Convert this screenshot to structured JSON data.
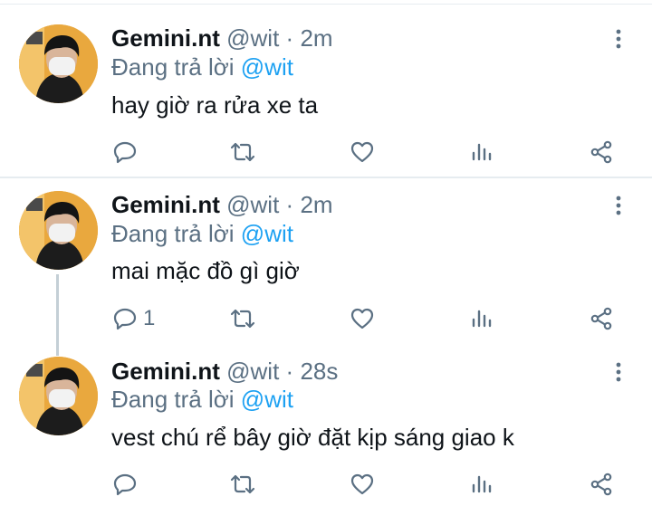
{
  "tweets": [
    {
      "name": "Gemini.nt",
      "handle": "@wit",
      "sep": "·",
      "time": "2m",
      "reply_prefix": "Đang trả lời",
      "reply_to": "@wit",
      "text": "hay giờ ra rửa xe ta",
      "reply_count": "",
      "icons": {
        "reply": "reply-icon",
        "retweet": "retweet-icon",
        "like": "heart-icon",
        "analytics": "analytics-icon",
        "share": "share-icon",
        "more": "more-vertical-icon"
      }
    },
    {
      "name": "Gemini.nt",
      "handle": "@wit",
      "sep": "·",
      "time": "2m",
      "reply_prefix": "Đang trả lời",
      "reply_to": "@wit",
      "text": "mai mặc đồ gì giờ",
      "reply_count": "1",
      "icons": {
        "reply": "reply-icon",
        "retweet": "retweet-icon",
        "like": "heart-icon",
        "analytics": "analytics-icon",
        "share": "share-icon",
        "more": "more-vertical-icon"
      }
    },
    {
      "name": "Gemini.nt",
      "handle": "@wit",
      "sep": "·",
      "time": "28s",
      "reply_prefix": "Đang trả lời",
      "reply_to": "@wit",
      "text": "vest chú rể bây giờ đặt kịp sáng giao k",
      "reply_count": "",
      "icons": {
        "reply": "reply-icon",
        "retweet": "retweet-icon",
        "like": "heart-icon",
        "analytics": "analytics-icon",
        "share": "share-icon",
        "more": "more-vertical-icon"
      }
    }
  ],
  "colors": {
    "name": "#0f1419",
    "secondary": "#5b7083",
    "mention": "#1da1f2",
    "divider": "#e6ecf0"
  }
}
